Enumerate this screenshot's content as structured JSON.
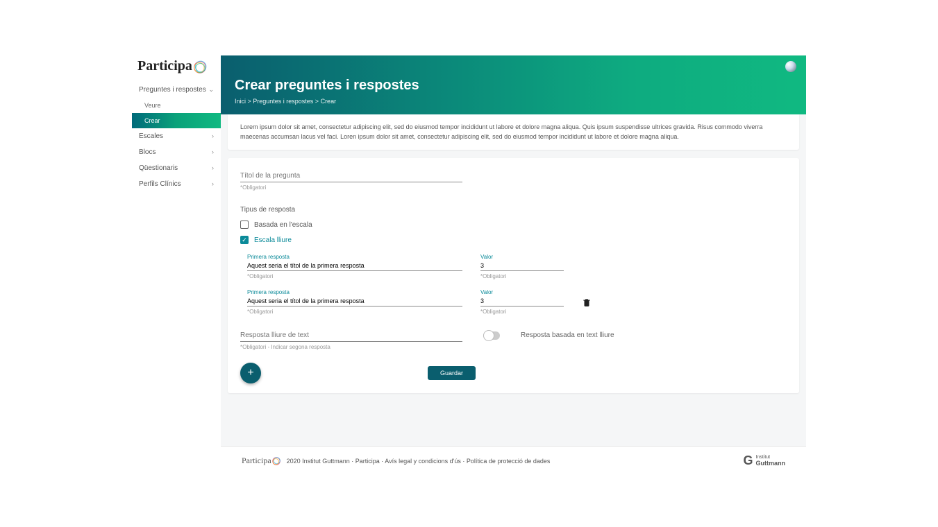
{
  "brand": {
    "name": "Participa"
  },
  "sidebar": {
    "items": [
      {
        "label": "Preguntes i respostes",
        "expandable": true,
        "expanded": true,
        "children": [
          {
            "label": "Veure",
            "active": false
          },
          {
            "label": "Crear",
            "active": true
          }
        ]
      },
      {
        "label": "Escales",
        "expandable": true
      },
      {
        "label": "Blocs",
        "expandable": true
      },
      {
        "label": "Qüestionaris",
        "expandable": true
      },
      {
        "label": "Perfils Clínics",
        "expandable": true
      }
    ]
  },
  "header": {
    "title": "Crear preguntes i respostes",
    "breadcrumb": "Inici > Preguntes i respostes > Crear"
  },
  "info_text": "Lorem ipsum dolor sit amet, consectetur adipiscing elit, sed do eiusmod tempor incididunt ut labore et dolore magna aliqua. Quis ipsum suspendisse ultrices gravida. Risus commodo viverra maecenas accumsan lacus vel faci. Loren ipsum dolor sit amet, consectetur adipiscing elit, sed do eiusmod tempor incididunt ut labore et dolore magna aliqua.",
  "form": {
    "title_field": {
      "placeholder": "Títol de la pregunta",
      "value": "",
      "helper": "*Obligatori"
    },
    "response_type_label": "Tipus de resposta",
    "options": [
      {
        "label": "Basada en l'escala",
        "checked": false
      },
      {
        "label": "Escala lliure",
        "checked": true
      }
    ],
    "responses": [
      {
        "label_title": "Primera resposta",
        "title": "Aquest seria el títol de la primera resposta",
        "label_value": "Valor",
        "value": "3",
        "helper": "*Obligatori",
        "deletable": false
      },
      {
        "label_title": "Primera resposta",
        "title": "Aquest seria el títol de la primera resposta",
        "label_value": "Valor",
        "value": "3",
        "helper": "*Obligatori",
        "deletable": true
      }
    ],
    "free_text": {
      "placeholder": "Resposta lliure de text",
      "helper": "*Obligatori - Indicar segona resposta",
      "toggle_label": "Resposta basada en text lliure"
    },
    "save_button": "Guardar",
    "add_button": "+"
  },
  "footer": {
    "brand": "Participa",
    "text": "2020 Institut Guttmann · Participa · Avís legal y condicions d'ús  ·  Política de protecció de dades",
    "org_small": "Institut",
    "org_main": "Guttmann"
  }
}
